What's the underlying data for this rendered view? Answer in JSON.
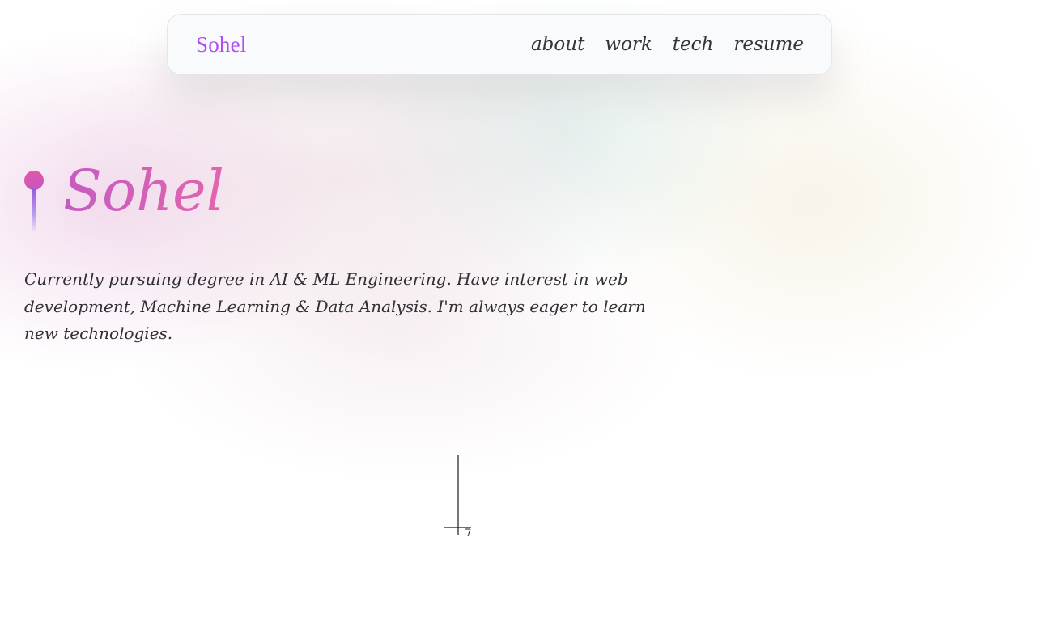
{
  "nav": {
    "brand": "Sohel",
    "links": [
      "about",
      "work",
      "tech",
      "resume"
    ]
  },
  "hero": {
    "title": "Sohel",
    "bio": "Currently pursuing degree in AI & ML Engineering. Have interest in web development, Machine Learning & Data Analysis. I'm always eager to learn new technologies."
  },
  "colors": {
    "brand": "#b04df0",
    "title_start": "#c45cc0",
    "title_end": "#e464ae",
    "text": "#2f2f36"
  },
  "icons": {
    "hero_pin": "pin-icon",
    "cursor": "cursor-glyph-icon"
  }
}
